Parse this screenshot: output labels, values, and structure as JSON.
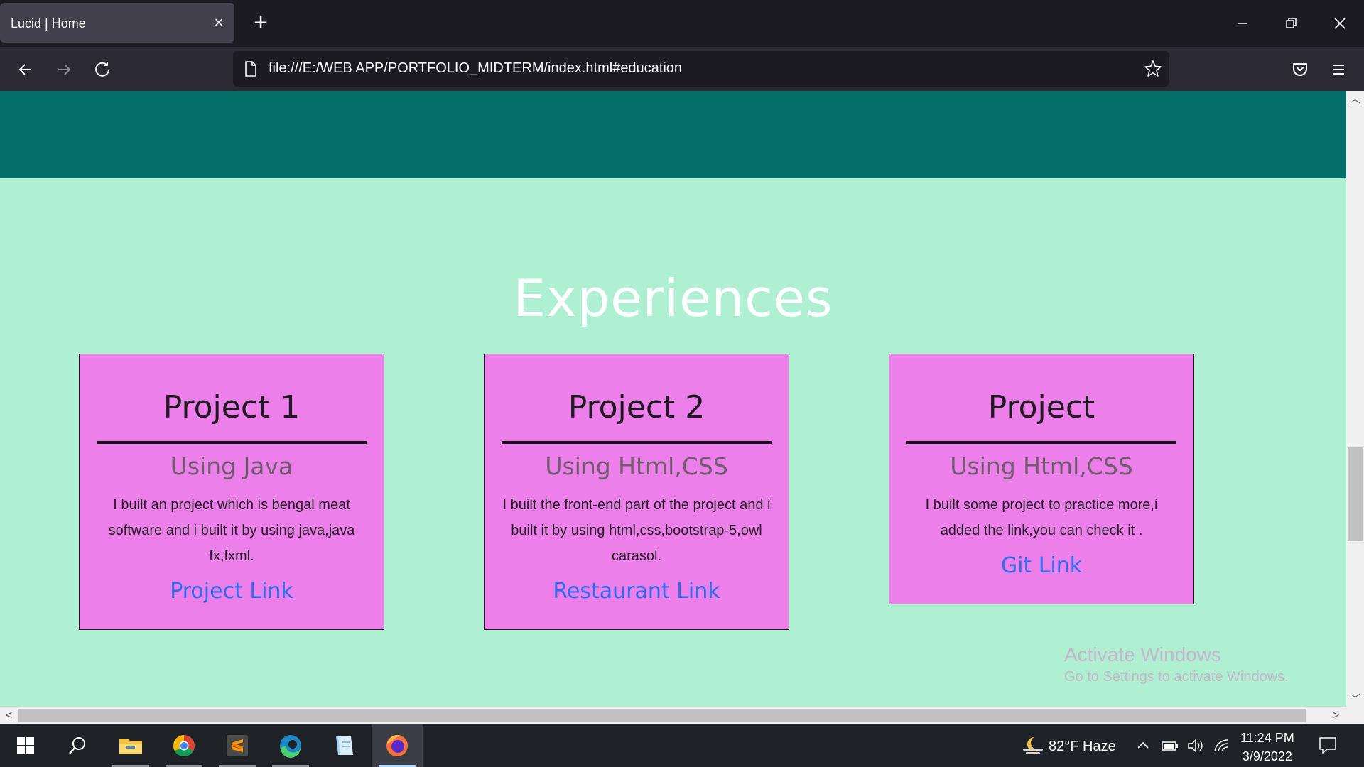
{
  "browser": {
    "tab_title": "Lucid | Home",
    "url": "file:///E:/WEB APP/PORTFOLIO_MIDTERM/index.html#education"
  },
  "page": {
    "section_title": "Experiences",
    "cards": [
      {
        "title": "Project 1",
        "subtitle": "Using Java",
        "description": "I built an project which is bengal meat software and i built it by using java,java fx,fxml.",
        "link": "Project Link"
      },
      {
        "title": "Project 2",
        "subtitle": "Using Html,CSS",
        "description": "I built the front-end part of the project and i built it by using html,css,bootstrap-5,owl carasol.",
        "link": "Restaurant Link"
      },
      {
        "title": "Project",
        "subtitle": "Using Html,CSS",
        "description": "I built some project to practice more,i added the link,you can check it .",
        "link": "Git Link"
      }
    ],
    "colors": {
      "hero": "#036e68",
      "background": "#aef0d1",
      "card": "#ed7fea",
      "link": "#2c6cf2"
    }
  },
  "watermark": {
    "title": "Activate Windows",
    "subtitle": "Go to Settings to activate Windows."
  },
  "taskbar": {
    "apps": [
      "start-icon",
      "search-icon",
      "file-explorer-icon",
      "chrome-icon",
      "sublime-text-icon",
      "edge-icon",
      "notepad-icon",
      "firefox-icon"
    ],
    "weather": "82°F  Haze",
    "time": "11:24 PM",
    "date": "3/9/2022"
  }
}
